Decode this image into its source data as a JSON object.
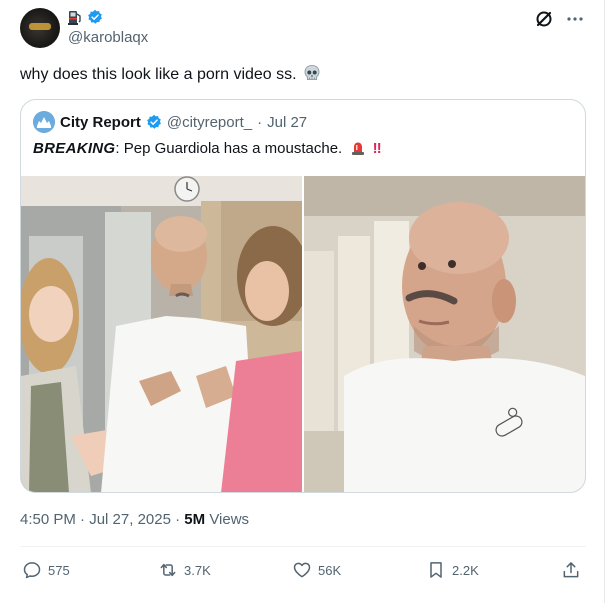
{
  "author": {
    "handle": "@karoblaqx",
    "badges": [
      "fuel-pump-icon",
      "verified-badge-icon"
    ]
  },
  "header_actions": [
    "grok-icon",
    "more-icon"
  ],
  "tweet": {
    "text": "why does this look like a porn video ss.",
    "emoji": "skull-icon"
  },
  "quote": {
    "name": "City Report",
    "handle": "@cityreport_",
    "separator": "·",
    "date": "Jul 27",
    "breaking_label": "BREAKING",
    "text": ": Pep Guardiola has a moustache.",
    "emoji": "police-light-icon",
    "exclaim": "‼"
  },
  "meta": {
    "time": "4:50 PM",
    "separator": "·",
    "date": "Jul 27, 2025",
    "views_count": "5M",
    "views_label": "Views"
  },
  "actions": {
    "replies": "575",
    "reposts": "3.7K",
    "likes": "56K",
    "bookmarks": "2.2K"
  },
  "colors": {
    "verified": "#1d9bf0",
    "text_secondary": "#536471",
    "border": "#cfd9de"
  }
}
